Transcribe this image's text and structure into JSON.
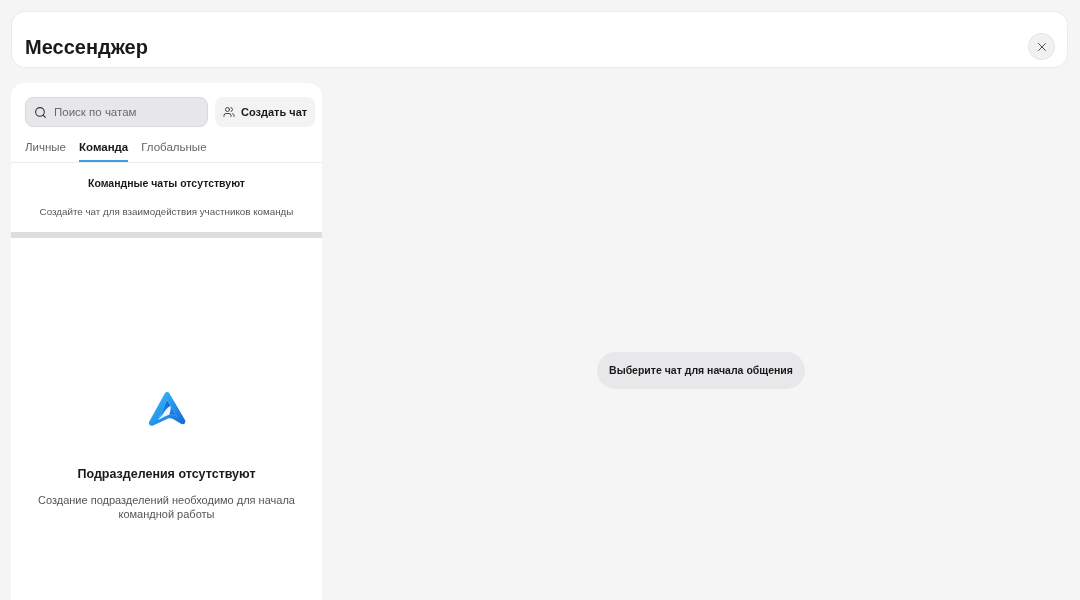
{
  "header": {
    "title": "Мессенджер"
  },
  "sidebar": {
    "search": {
      "placeholder": "Поиск по чатам"
    },
    "create_button": {
      "label": "Создать чат"
    },
    "tabs": [
      {
        "label": "Личные",
        "selected": false
      },
      {
        "label": "Команда",
        "selected": true
      },
      {
        "label": "Глобальные",
        "selected": false
      }
    ],
    "chats_empty": {
      "title": "Командные чаты отсутствуют",
      "description": "Создайте чат для взаимодействия участников команды"
    },
    "departments_empty": {
      "title": "Подразделения отсутствуют",
      "description": "Создание подразделений необходимо для начала командной работы"
    }
  },
  "main": {
    "hint": "Выберите чат для начала общения"
  }
}
